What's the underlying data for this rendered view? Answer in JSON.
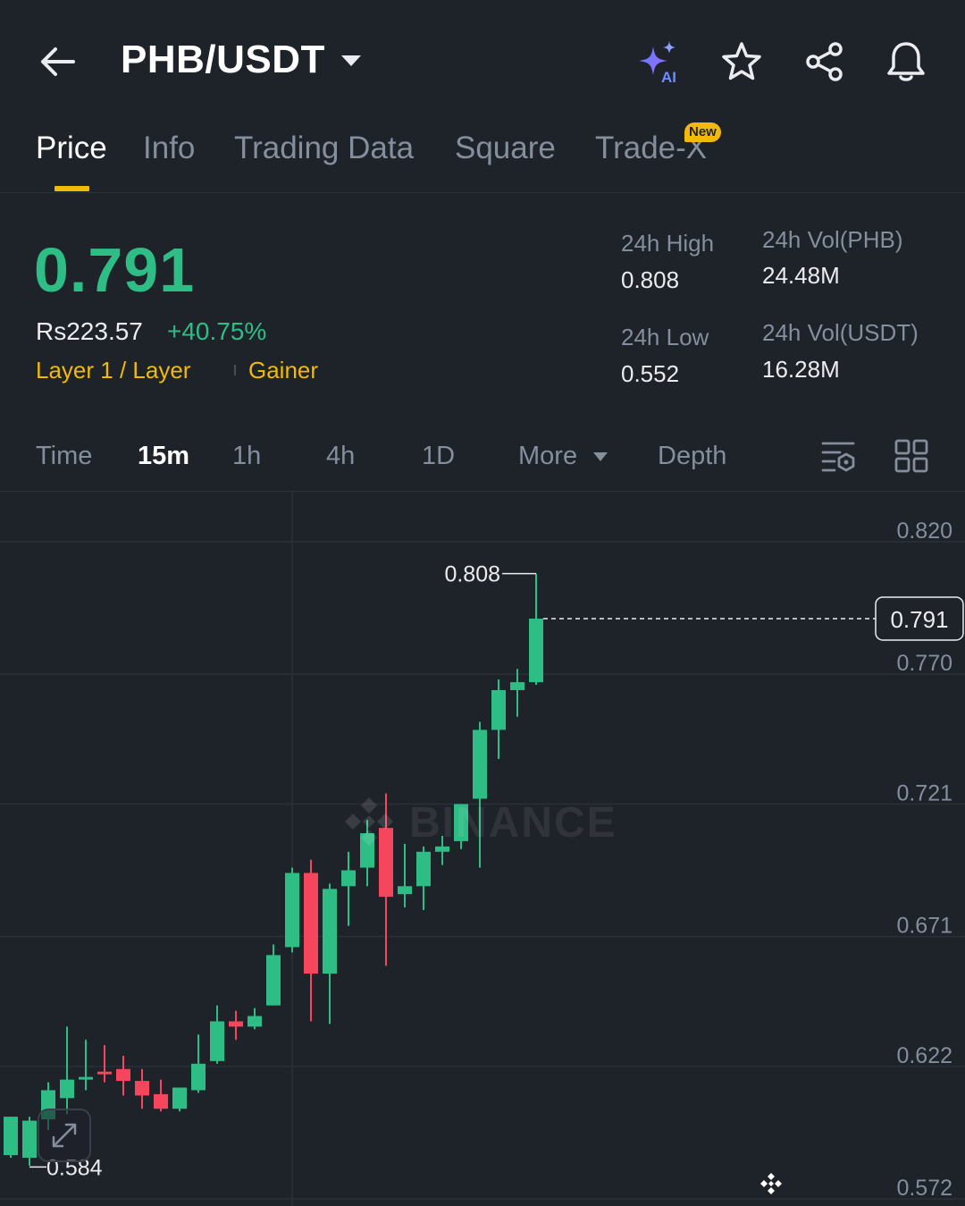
{
  "header": {
    "pair": "PHB/USDT",
    "icons": [
      "back-arrow-icon",
      "chevron-down-icon",
      "ai-sparkle-icon",
      "star-icon",
      "share-icon",
      "bell-icon"
    ],
    "ai_label": "AI"
  },
  "tabs": [
    {
      "label": "Price",
      "active": true
    },
    {
      "label": "Info",
      "active": false
    },
    {
      "label": "Trading Data",
      "active": false
    },
    {
      "label": "Square",
      "active": false
    },
    {
      "label": "Trade-X",
      "active": false,
      "badge": "New"
    }
  ],
  "ticker": {
    "last_price": "0.791",
    "fiat_price": "Rs223.57",
    "change_pct": "+40.75%",
    "tag_category": "Layer 1 / Layer",
    "tag_gainer": "Gainer"
  },
  "stats": {
    "high_label": "24h High",
    "high_value": "0.808",
    "low_label": "24h Low",
    "low_value": "0.552",
    "vol_base_label": "24h Vol(PHB)",
    "vol_base_value": "24.48M",
    "vol_quote_label": "24h Vol(USDT)",
    "vol_quote_value": "16.28M"
  },
  "intervals": {
    "items": [
      {
        "label": "Time",
        "active": false
      },
      {
        "label": "15m",
        "active": true
      },
      {
        "label": "1h",
        "active": false
      },
      {
        "label": "4h",
        "active": false
      },
      {
        "label": "1D",
        "active": false
      },
      {
        "label": "More",
        "active": false
      },
      {
        "label": "Depth",
        "active": false
      }
    ],
    "icons": [
      "indicator-settings-icon",
      "layout-grid-icon"
    ]
  },
  "colors": {
    "up": "#2ebd85",
    "down": "#f6465d",
    "accent": "#f0b90b",
    "background": "#1e2229",
    "muted": "#848e9c"
  },
  "chart_data": {
    "type": "candlestick",
    "interval": "15m",
    "y_ticks": [
      "0.820",
      "0.770",
      "0.721",
      "0.671",
      "0.622",
      "0.572"
    ],
    "ylim": [
      0.572,
      0.82
    ],
    "last_price_label": "0.791",
    "high_marker": "0.808",
    "low_marker": "0.584",
    "watermark": "BINANCE",
    "candles": [
      {
        "o": 0.5885,
        "h": 0.603,
        "l": 0.5875,
        "c": 0.603
      },
      {
        "o": 0.5875,
        "h": 0.603,
        "l": 0.5845,
        "c": 0.6015
      },
      {
        "o": 0.602,
        "h": 0.616,
        "l": 0.598,
        "c": 0.613
      },
      {
        "o": 0.61,
        "h": 0.637,
        "l": 0.604,
        "c": 0.617
      },
      {
        "o": 0.617,
        "h": 0.632,
        "l": 0.613,
        "c": 0.618
      },
      {
        "o": 0.62,
        "h": 0.63,
        "l": 0.616,
        "c": 0.619
      },
      {
        "o": 0.621,
        "h": 0.626,
        "l": 0.611,
        "c": 0.6165
      },
      {
        "o": 0.6165,
        "h": 0.621,
        "l": 0.606,
        "c": 0.611
      },
      {
        "o": 0.6115,
        "h": 0.617,
        "l": 0.605,
        "c": 0.606
      },
      {
        "o": 0.606,
        "h": 0.614,
        "l": 0.605,
        "c": 0.614
      },
      {
        "o": 0.613,
        "h": 0.634,
        "l": 0.612,
        "c": 0.623
      },
      {
        "o": 0.624,
        "h": 0.645,
        "l": 0.623,
        "c": 0.639
      },
      {
        "o": 0.639,
        "h": 0.643,
        "l": 0.632,
        "c": 0.637
      },
      {
        "o": 0.637,
        "h": 0.644,
        "l": 0.636,
        "c": 0.641
      },
      {
        "o": 0.645,
        "h": 0.668,
        "l": 0.645,
        "c": 0.664
      },
      {
        "o": 0.667,
        "h": 0.697,
        "l": 0.665,
        "c": 0.695
      },
      {
        "o": 0.695,
        "h": 0.7,
        "l": 0.639,
        "c": 0.657
      },
      {
        "o": 0.657,
        "h": 0.691,
        "l": 0.638,
        "c": 0.689
      },
      {
        "o": 0.69,
        "h": 0.703,
        "l": 0.675,
        "c": 0.696
      },
      {
        "o": 0.697,
        "h": 0.715,
        "l": 0.69,
        "c": 0.71
      },
      {
        "o": 0.712,
        "h": 0.725,
        "l": 0.66,
        "c": 0.686
      },
      {
        "o": 0.687,
        "h": 0.706,
        "l": 0.682,
        "c": 0.69
      },
      {
        "o": 0.69,
        "h": 0.705,
        "l": 0.681,
        "c": 0.703
      },
      {
        "o": 0.703,
        "h": 0.709,
        "l": 0.698,
        "c": 0.705
      },
      {
        "o": 0.707,
        "h": 0.721,
        "l": 0.704,
        "c": 0.721
      },
      {
        "o": 0.723,
        "h": 0.752,
        "l": 0.697,
        "c": 0.749
      },
      {
        "o": 0.749,
        "h": 0.768,
        "l": 0.738,
        "c": 0.764
      },
      {
        "o": 0.764,
        "h": 0.772,
        "l": 0.754,
        "c": 0.767
      },
      {
        "o": 0.767,
        "h": 0.808,
        "l": 0.766,
        "c": 0.791
      }
    ]
  }
}
